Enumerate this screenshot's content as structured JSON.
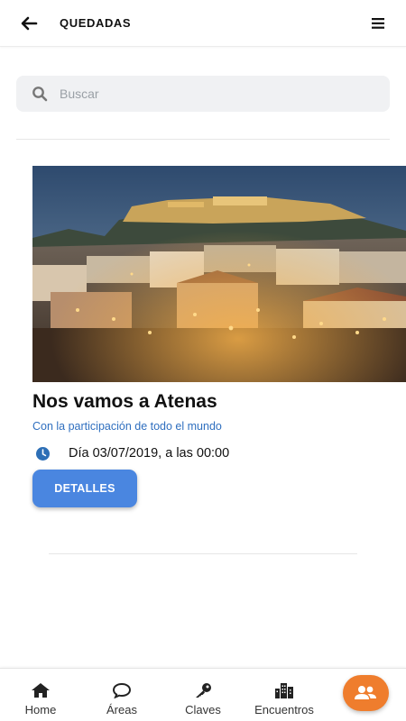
{
  "header": {
    "title": "QUEDADAS",
    "back_icon": "arrow-left-icon",
    "menu_icon": "hamburger-menu-icon"
  },
  "search": {
    "placeholder": "Buscar",
    "value": "",
    "icon": "search-icon"
  },
  "event": {
    "image": "athens-acropolis-photo",
    "title": "Nos vamos a Atenas",
    "subtitle": "Con la participación de todo el mundo",
    "date_icon": "clock-icon",
    "date_text": "Día 03/07/2019, a las 00:00",
    "details_label": "DETALLES"
  },
  "bottom_nav": {
    "items": [
      {
        "label": "Home",
        "icon": "home-icon"
      },
      {
        "label": "Áreas",
        "icon": "chat-bubble-icon"
      },
      {
        "label": "Claves",
        "icon": "key-icon"
      },
      {
        "label": "Encuentros",
        "icon": "city-icon"
      }
    ],
    "fab_icon": "group-users-icon"
  },
  "colors": {
    "accent_blue": "#4a86e0",
    "link_blue": "#2f6fbf",
    "fab_orange": "#ef7d2d",
    "clock_blue": "#2d6fb6"
  }
}
